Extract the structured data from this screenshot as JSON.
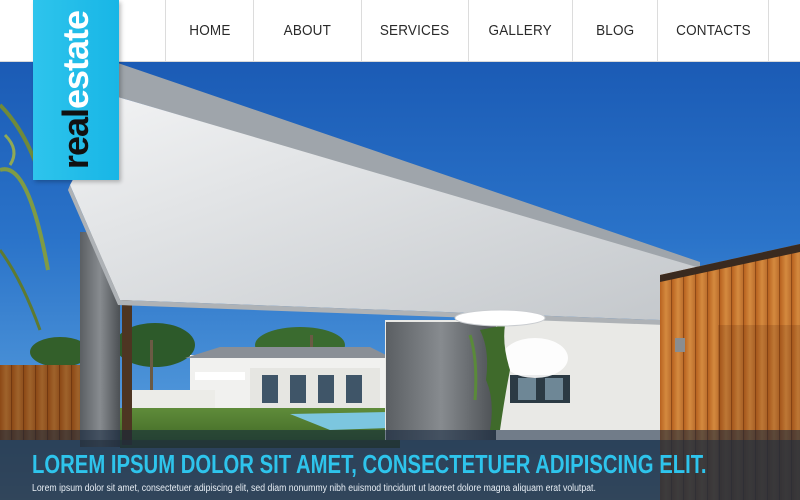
{
  "logo": {
    "word1": "real",
    "word2": "estate"
  },
  "nav": {
    "items": [
      {
        "label": "HOME"
      },
      {
        "label": "ABOUT"
      },
      {
        "label": "SERVICES"
      },
      {
        "label": "GALLERY"
      },
      {
        "label": "BLOG"
      },
      {
        "label": "CONTACTS"
      }
    ]
  },
  "hero": {
    "headline": "LOREM IPSUM DOLOR SIT AMET, CONSECTETUER ADIPISCING ELIT.",
    "subtext": "Lorem ipsum dolor sit amet, consectetuer adipiscing elit, sed diam nonummy nibh euismod tincidunt ut laoreet dolore magna aliquam erat volutpat."
  },
  "colors": {
    "accent": "#2ec4ec",
    "sky": "#1d5fb8",
    "wood": "#c8752e"
  }
}
